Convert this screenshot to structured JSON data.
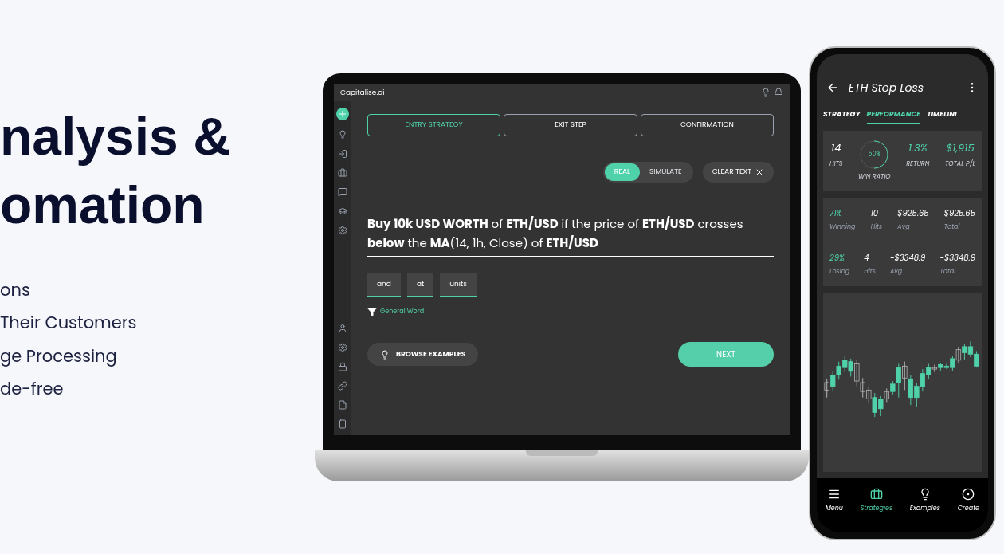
{
  "hero": {
    "title_lines": [
      "nalysis &",
      "omation"
    ],
    "bullets": [
      "ons",
      "Their Customers",
      "ge Processing",
      "de-free"
    ]
  },
  "laptop": {
    "app_name": "Capitalise.ai",
    "steps": [
      {
        "label": "ENTRY STRATEGY",
        "selected": true
      },
      {
        "label": "EXIT STEP",
        "selected": false
      },
      {
        "label": "CONFIRMATION",
        "selected": false
      }
    ],
    "mode_toggle": [
      {
        "label": "REAL",
        "selected": true
      },
      {
        "label": "SIMULATE",
        "selected": false
      }
    ],
    "clear_button": "CLEAR TEXT",
    "strategy_text": "**Buy 10k USD WORTH** of **ETH/USD** if the price of **ETH/USD** crosses **below** the **MA**(14, 1h, Close) of **ETH/USD**",
    "suggestions": [
      "and",
      "at",
      "units"
    ],
    "filter_label": "General Word",
    "browse_button": "BROWSE EXAMPLES",
    "next_button": "NEXT"
  },
  "phone": {
    "title": "ETH Stop Loss",
    "tabs": [
      {
        "label": "STRATEGY",
        "selected": false
      },
      {
        "label": "PERFORMANCE",
        "selected": true
      },
      {
        "label": "TIMELINI",
        "selected": false
      }
    ],
    "summary": [
      {
        "kind": "plain",
        "value": "14",
        "label": "HITS"
      },
      {
        "kind": "gauge",
        "value": "50%",
        "label": "WIN RATIO",
        "level": 0.5
      },
      {
        "kind": "highlight",
        "value": "1.3%",
        "label": "RETURN"
      },
      {
        "kind": "highlight",
        "value": "$1,915",
        "label": "TOTAL P/L"
      }
    ],
    "rows": [
      {
        "cells": [
          {
            "value": "71%",
            "label": "Winning"
          },
          {
            "value": "10",
            "label": "Hits"
          },
          {
            "value": "$925.65",
            "label": "Avg"
          },
          {
            "value": "$925.65",
            "label": "Total"
          }
        ]
      },
      {
        "cells": [
          {
            "value": "29%",
            "label": "Losing"
          },
          {
            "value": "4",
            "label": "Hits"
          },
          {
            "value": "-$3348.9",
            "label": "Avg"
          },
          {
            "value": "-$3348.9",
            "label": "Total"
          }
        ]
      }
    ],
    "nav": [
      {
        "label": "Menu",
        "selected": false
      },
      {
        "label": "Strategies",
        "selected": true
      },
      {
        "label": "Examples",
        "selected": false
      },
      {
        "label": "Create",
        "selected": false
      }
    ]
  }
}
